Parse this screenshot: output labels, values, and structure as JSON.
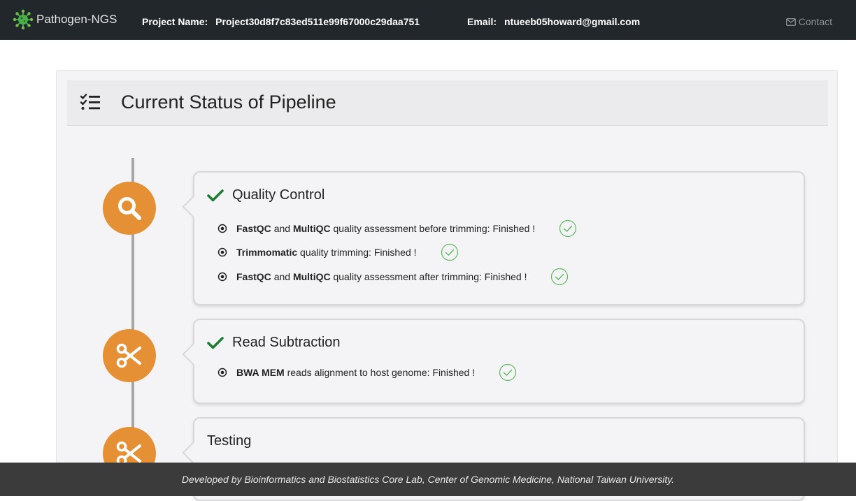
{
  "navbar": {
    "brand": "Pathogen-NGS",
    "project_label": "Project Name:",
    "project_value": "Project30d8f7c83ed511e99f67000c29daa751",
    "email_label": "Email:",
    "email_value": "ntueeb05howard@gmail.com",
    "contact_label": "Contact"
  },
  "panel": {
    "title": "Current Status of Pipeline"
  },
  "stages": [
    {
      "title": "Quality Control",
      "icon": "search-icon",
      "completed": true,
      "steps": [
        {
          "tool1": "FastQC",
          "and": "and",
          "tool2": "MultiQC",
          "text": "quality assessment before trimming: Finished !"
        },
        {
          "tool1": "Trimmomatic",
          "text": "quality trimming: Finished !"
        },
        {
          "tool1": "FastQC",
          "and": "and",
          "tool2": "MultiQC",
          "text": "quality assessment after trimming: Finished !"
        }
      ]
    },
    {
      "title": "Read Subtraction",
      "icon": "scissors-icon",
      "completed": true,
      "steps": [
        {
          "tool1": "BWA MEM",
          "text": "reads alignment to host genome: Finished !"
        }
      ]
    },
    {
      "title": "Testing",
      "icon": "scissors-icon",
      "completed": false,
      "steps": []
    }
  ],
  "footer": {
    "text": "Developed by Bioinformatics and Biostatistics Core Lab, Center of Genomic Medicine, National Taiwan University."
  },
  "colors": {
    "navbar": "#22272b",
    "accent_orange": "#e69036",
    "check_green": "#1e7b34",
    "done_green": "#5cb85c",
    "footer": "#3b3b3b"
  }
}
